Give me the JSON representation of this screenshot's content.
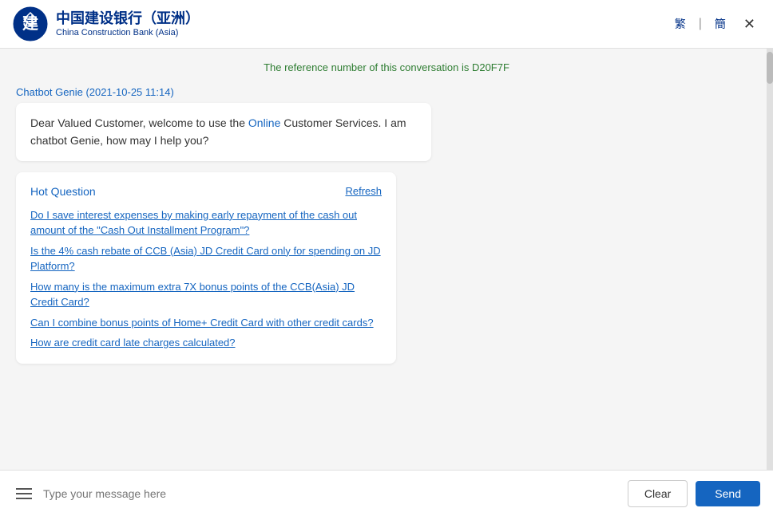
{
  "header": {
    "logo_cn": "中国建设银行（亚洲）",
    "logo_en": "China Construction Bank (Asia)",
    "lang_traditional": "繁",
    "lang_simplified": "簡",
    "close_label": "✕"
  },
  "chat": {
    "reference_msg": "The reference number of this conversation is D20F7F",
    "chatbot_label": "Chatbot Genie (2021-10-25 11:14)",
    "welcome_msg_part1": "Dear Valued Customer, welcome to use the ",
    "welcome_msg_highlight": "Online",
    "welcome_msg_part2": " Customer Services. I am chatbot Genie, how may I help you?"
  },
  "hot_question": {
    "title": "Hot Question",
    "refresh_label": "Refresh",
    "links": [
      "Do I save interest expenses by making early repayment of the cash out amount of the \"Cash Out Installment Program\"?",
      "Is the 4% cash rebate of CCB (Asia) JD Credit Card only for spending on JD Platform?",
      "How many is the maximum extra 7X bonus points of the CCB(Asia) JD Credit Card?",
      "Can I combine bonus points of Home+ Credit Card with other credit cards?",
      "How are credit card late charges calculated?"
    ]
  },
  "input": {
    "placeholder": "Type your message here",
    "clear_label": "Clear",
    "send_label": "Send"
  }
}
